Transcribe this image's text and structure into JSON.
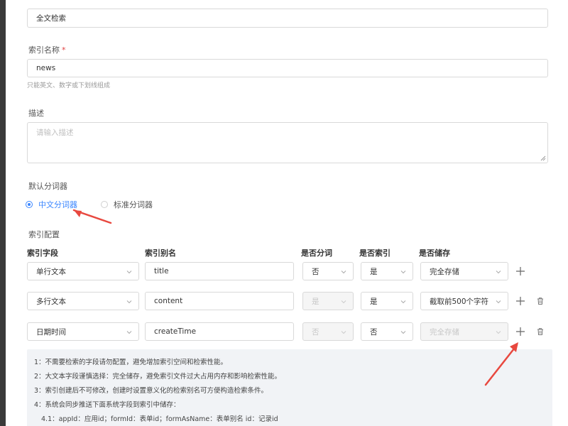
{
  "form": {
    "index_identity_value": "全文检索",
    "index_name_label": "索引名称",
    "index_name_required": "*",
    "index_name_value": "news",
    "index_name_hint": "只能英文、数字或下划线组成",
    "description_label": "描述",
    "description_placeholder": "请输入描述",
    "tokenizer_label": "默认分词器",
    "tokenizer_options": [
      "中文分词器",
      "标准分词器"
    ],
    "tokenizer_selected": "中文分词器",
    "index_config_label": "索引配置"
  },
  "table": {
    "headers": [
      "索引字段",
      "索引别名",
      "是否分词",
      "是否索引",
      "是否储存"
    ],
    "rows": [
      {
        "field": "单行文本",
        "alias": "title",
        "tokenize": "否",
        "index": "是",
        "store": "完全存储",
        "tokenize_disabled": false,
        "store_disabled": false,
        "deletable": false
      },
      {
        "field": "多行文本",
        "alias": "content",
        "tokenize": "是",
        "index": "是",
        "store": "截取前500个字符",
        "tokenize_disabled": true,
        "store_disabled": false,
        "deletable": true
      },
      {
        "field": "日期时间",
        "alias": "createTime",
        "tokenize": "否",
        "index": "否",
        "store": "完全存储",
        "tokenize_disabled": true,
        "store_disabled": true,
        "deletable": true
      }
    ]
  },
  "notes": [
    "1：不需要检索的字段请勿配置，避免增加索引空间和检索性能。",
    "2：大文本字段谨慎选择：完全储存，避免索引文件过大占用内存和影响检索性能。",
    "3：索引创建后不可修改，创建时设置意义化的检索别名可方便构造检索条件。",
    "4：系统会同步推送下面系统字段到索引中储存：",
    "4.1：appId：应用id；formId：表单id；formAsName：表单别名 id：记录id"
  ],
  "colors": {
    "accent": "#3a86ff",
    "annotation_arrow": "#e8483f"
  },
  "icons": [
    "chevron-down-icon",
    "plus-icon",
    "trash-icon",
    "annotation-arrow"
  ]
}
